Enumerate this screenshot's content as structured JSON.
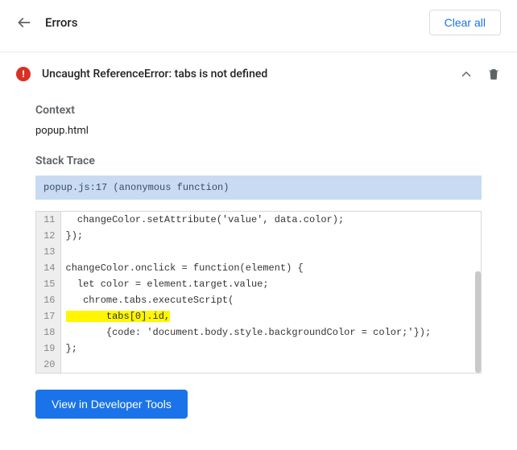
{
  "header": {
    "title": "Errors",
    "clear_all": "Clear all"
  },
  "error": {
    "message": "Uncaught ReferenceError: tabs is not defined"
  },
  "context": {
    "label": "Context",
    "value": "popup.html"
  },
  "stack_trace": {
    "label": "Stack Trace",
    "frame": "popup.js:17 (anonymous function)"
  },
  "code": {
    "lines": [
      {
        "n": 11,
        "t": "  changeColor.setAttribute('value', data.color);",
        "hl": false
      },
      {
        "n": 12,
        "t": "});",
        "hl": false
      },
      {
        "n": 13,
        "t": "",
        "hl": false
      },
      {
        "n": 14,
        "t": "changeColor.onclick = function(element) {",
        "hl": false
      },
      {
        "n": 15,
        "t": "  let color = element.target.value;",
        "hl": false
      },
      {
        "n": 16,
        "t": "   chrome.tabs.executeScript(",
        "hl": false
      },
      {
        "n": 17,
        "t": "       tabs[0].id,",
        "hl": true
      },
      {
        "n": 18,
        "t": "       {code: 'document.body.style.backgroundColor = color;'});",
        "hl": false
      },
      {
        "n": 19,
        "t": "};",
        "hl": false
      },
      {
        "n": 20,
        "t": "",
        "hl": false
      }
    ]
  },
  "footer": {
    "view_btn": "View in Developer Tools"
  }
}
